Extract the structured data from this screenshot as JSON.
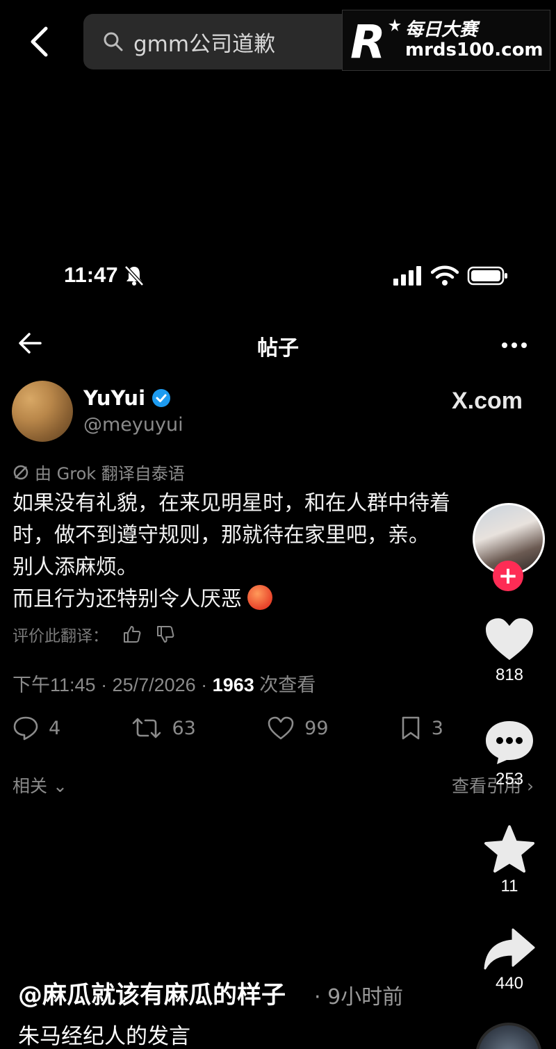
{
  "search": {
    "query": "gmm公司道歉"
  },
  "watermark": {
    "line1": "每日大赛",
    "line2": "mrds100.com"
  },
  "status_bar": {
    "time": "11:47"
  },
  "post_header": {
    "title": "帖子"
  },
  "author": {
    "name": "YuYui",
    "handle": "@meyuyui",
    "verified": true
  },
  "xcom": "X.com",
  "translation_note": "由 Grok 翻译自泰语",
  "post_text": "如果没有礼貌，在来见明星时，和在人群中待着\n时，做不到遵守规则，那就待在家里吧，亲。\n别人添麻烦。\n而且行为还特别令人厌恶",
  "rate_label": "评价此翻译：",
  "meta": {
    "time_date": "下午11:45 · 25/7/2026 · ",
    "views": "1963",
    "views_label": " 次查看"
  },
  "stats": {
    "replies": "4",
    "reposts": "63",
    "likes": "99",
    "bookmarks": "3"
  },
  "related_label": "相关",
  "view_more_label": "查看引用",
  "side_actions": {
    "likes": "818",
    "comments": "253",
    "favorites": "11",
    "shares": "440"
  },
  "caption": {
    "user": "@麻瓜就该有麻瓜的样子",
    "time": "· 9小时前",
    "text": "朱马经纪人的发言"
  },
  "colors": {
    "background": "#000000",
    "verified": "#1d9bf0",
    "follow": "#fe2c55",
    "muted_text": "#8b8b8b"
  }
}
